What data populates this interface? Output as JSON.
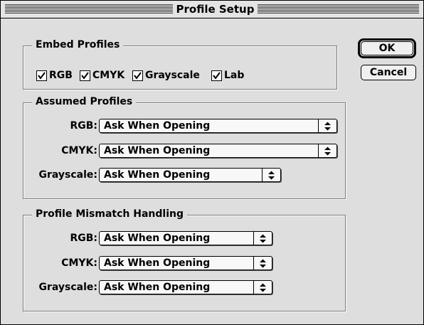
{
  "window": {
    "title": "Profile Setup"
  },
  "embed": {
    "title": "Embed Profiles",
    "options": [
      {
        "label": "RGB",
        "checked": true
      },
      {
        "label": "CMYK",
        "checked": true
      },
      {
        "label": "Grayscale",
        "checked": true
      },
      {
        "label": "Lab",
        "checked": true
      }
    ]
  },
  "assumed": {
    "title": "Assumed Profiles",
    "rows": [
      {
        "label": "RGB:",
        "value": "Ask When Opening"
      },
      {
        "label": "CMYK:",
        "value": "Ask When Opening"
      },
      {
        "label": "Grayscale:",
        "value": "Ask When Opening"
      }
    ]
  },
  "mismatch": {
    "title": "Profile Mismatch Handling",
    "rows": [
      {
        "label": "RGB:",
        "value": "Ask When Opening"
      },
      {
        "label": "CMYK:",
        "value": "Ask When Opening"
      },
      {
        "label": "Grayscale:",
        "value": "Ask When Opening"
      }
    ]
  },
  "buttons": {
    "ok": "OK",
    "cancel": "Cancel"
  }
}
